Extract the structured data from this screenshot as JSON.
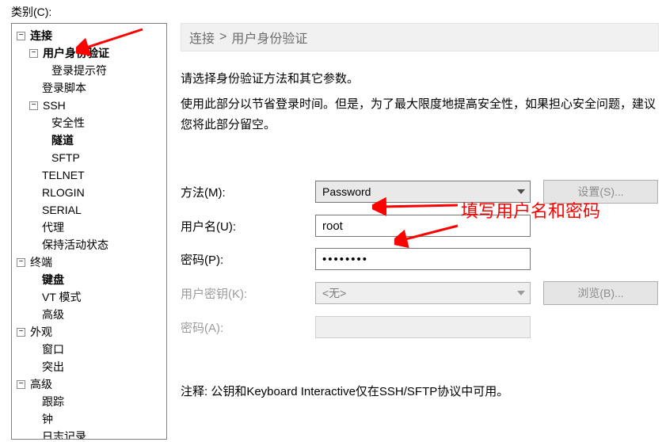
{
  "category_label": "类别(C):",
  "tree": {
    "connection": "连接",
    "user_auth": "用户身份验证",
    "login_prompt": "登录提示符",
    "login_script": "登录脚本",
    "ssh": "SSH",
    "security": "安全性",
    "tunnel": "隧道",
    "sftp": "SFTP",
    "telnet": "TELNET",
    "rlogin": "RLOGIN",
    "serial": "SERIAL",
    "proxy": "代理",
    "keepalive": "保持活动状态",
    "terminal": "终端",
    "keyboard": "键盘",
    "vtmodes": "VT 模式",
    "term_adv": "高级",
    "appearance": "外观",
    "window": "窗口",
    "highlight": "突出",
    "advanced": "高级",
    "tracking": "跟踪",
    "bell": "钟",
    "logging": "日志记录"
  },
  "breadcrumb": {
    "root": "连接",
    "leaf": "用户身份验证"
  },
  "intro": {
    "line1": "请选择身份验证方法和其它参数。",
    "line2": "使用此部分以节省登录时间。但是，为了最大限度地提高安全性，如果担心安全问题，建议您将此部分留空。"
  },
  "form": {
    "method_label": "方法(M):",
    "method_value": "Password",
    "settings_btn": "设置(S)...",
    "username_label": "用户名(U):",
    "username_value": "root",
    "password_label": "密码(P):",
    "password_value": "••••••••",
    "userkey_label": "用户密钥(K):",
    "userkey_value": "<无>",
    "browse_btn": "浏览(B)...",
    "password2_label": "密码(A):"
  },
  "note": "注释: 公钥和Keyboard Interactive仅在SSH/SFTP协议中可用。",
  "annotation": "填写用户名和密码"
}
